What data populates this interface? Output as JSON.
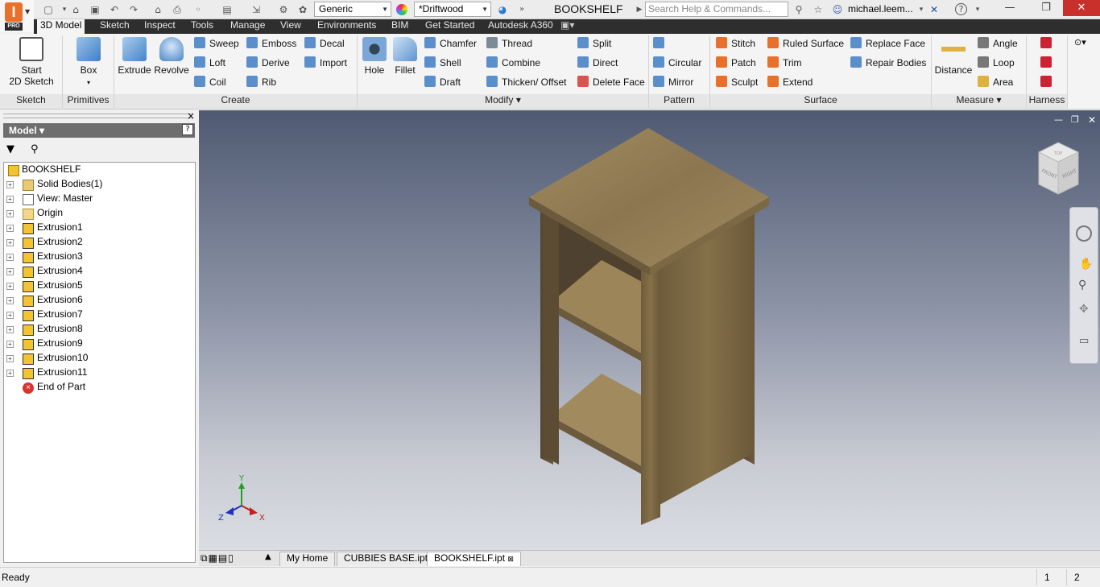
{
  "app": {
    "logo_letter": "I",
    "edition": "PRO",
    "title": "BOOKSHELF"
  },
  "qat": {
    "appearance": "Generic",
    "material": "*Driftwood",
    "search_placeholder": "Search Help & Commands...",
    "user": "michael.leem..."
  },
  "tabs": [
    "3D Model",
    "Sketch",
    "Inspect",
    "Tools",
    "Manage",
    "View",
    "Environments",
    "BIM",
    "Get Started",
    "Autodesk A360"
  ],
  "ribbon": {
    "sketch": {
      "label": "Sketch",
      "start": "Start",
      "sketch2d": "2D Sketch"
    },
    "primitives": {
      "label": "Primitives",
      "box": "Box"
    },
    "create": {
      "label": "Create",
      "extrude": "Extrude",
      "revolve": "Revolve",
      "sweep": "Sweep",
      "loft": "Loft",
      "coil": "Coil",
      "emboss": "Emboss",
      "derive": "Derive",
      "rib": "Rib",
      "decal": "Decal",
      "import": "Import"
    },
    "modify": {
      "label": "Modify",
      "hole": "Hole",
      "fillet": "Fillet",
      "chamfer": "Chamfer",
      "shell": "Shell",
      "draft": "Draft",
      "thread": "Thread",
      "combine": "Combine",
      "thicken": "Thicken/ Offset",
      "split": "Split",
      "direct": "Direct",
      "delete_face": "Delete Face"
    },
    "pattern": {
      "label": "Pattern",
      "circular": "Circular",
      "mirror": "Mirror"
    },
    "surface": {
      "label": "Surface",
      "stitch": "Stitch",
      "patch": "Patch",
      "sculpt": "Sculpt",
      "ruled": "Ruled Surface",
      "trim": "Trim",
      "extend": "Extend",
      "replace": "Replace Face",
      "repair": "Repair Bodies"
    },
    "measure": {
      "label": "Measure",
      "distance": "Distance",
      "angle": "Angle",
      "loop": "Loop",
      "area": "Area"
    },
    "harness": {
      "label": "Harness"
    }
  },
  "browser": {
    "tab_label": "Model",
    "nodes": [
      {
        "label": "BOOKSHELF",
        "icon": "part-icon"
      },
      {
        "label": "Solid Bodies(1)",
        "icon": "solid-bodies-icon"
      },
      {
        "label": "View: Master",
        "icon": "view-icon"
      },
      {
        "label": "Origin",
        "icon": "folder-icon"
      },
      {
        "label": "Extrusion1",
        "icon": "extrusion-icon"
      },
      {
        "label": "Extrusion2",
        "icon": "extrusion-icon"
      },
      {
        "label": "Extrusion3",
        "icon": "extrusion-icon"
      },
      {
        "label": "Extrusion4",
        "icon": "extrusion-icon"
      },
      {
        "label": "Extrusion5",
        "icon": "extrusion-icon"
      },
      {
        "label": "Extrusion6",
        "icon": "extrusion-icon"
      },
      {
        "label": "Extrusion7",
        "icon": "extrusion-icon"
      },
      {
        "label": "Extrusion8",
        "icon": "extrusion-icon"
      },
      {
        "label": "Extrusion9",
        "icon": "extrusion-icon"
      },
      {
        "label": "Extrusion10",
        "icon": "extrusion-icon"
      },
      {
        "label": "Extrusion11",
        "icon": "extrusion-icon"
      },
      {
        "label": "End of Part",
        "icon": "end-of-part-icon"
      }
    ]
  },
  "viewcube": {
    "front": "FRONT",
    "right": "RIGHT",
    "top": "TOP"
  },
  "axes": {
    "x": "X",
    "y": "Y",
    "z": "Z"
  },
  "doc_tabs": {
    "home": "My Home",
    "tab1": "CUBBIES BASE.ipt",
    "tab2": "BOOKSHELF.ipt"
  },
  "status": {
    "text": "Ready",
    "n1": "1",
    "n2": "2"
  },
  "colors": {
    "accent": "#e8702a",
    "wood": "#8b7650"
  }
}
